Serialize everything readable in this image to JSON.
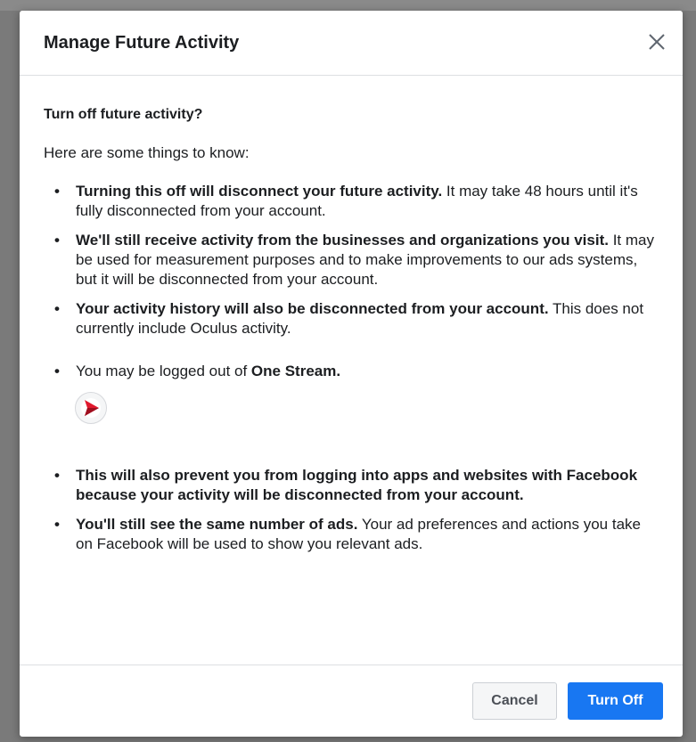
{
  "dialog": {
    "title": "Manage Future Activity",
    "close_icon": "close-icon",
    "subtitle": "Turn off future activity?",
    "intro": "Here are some things to know:",
    "items": [
      {
        "bold": "Turning this off will disconnect your future activity.",
        "text": " It may take 48 hours until it's fully disconnected from your account."
      },
      {
        "bold": "We'll still receive activity from the businesses and organizations you visit.",
        "text": " It may be used for measurement purposes and to make improvements to our ads systems, but it will be disconnected from your account."
      },
      {
        "bold": "Your activity history will also be disconnected from your account.",
        "text": " This does not currently include Oculus activity."
      },
      {
        "prefix": "You may be logged out of ",
        "bold": "One Stream.",
        "app_icon": "onestream-app-icon"
      },
      {
        "bold": "This will also prevent you from logging into apps and websites with Facebook because your activity will be disconnected from your account.",
        "text": ""
      },
      {
        "bold": "You'll still see the same number of ads.",
        "text": " Your ad preferences and actions you take on Facebook will be used to show you relevant ads."
      }
    ]
  },
  "footer": {
    "cancel_label": "Cancel",
    "turn_off_label": "Turn Off"
  },
  "colors": {
    "primary": "#1877f2",
    "text": "#1c1e21",
    "divider": "#dddfe2",
    "app_icon_red": "#e0182d"
  }
}
